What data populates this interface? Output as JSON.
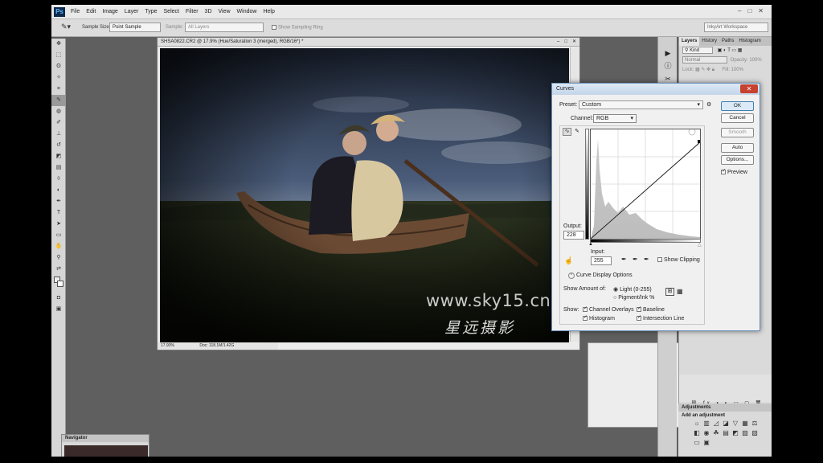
{
  "app": {
    "logo": "Ps",
    "workspace": "InkyArt Workspace"
  },
  "menu": [
    "File",
    "Edit",
    "Image",
    "Layer",
    "Type",
    "Select",
    "Filter",
    "3D",
    "View",
    "Window",
    "Help"
  ],
  "options": {
    "sample_size_label": "Sample Size:",
    "sample_size_value": "Point Sample",
    "sample_label": "Sample:",
    "sample_value": "All Layers",
    "show_ring_label": "Show Sampling Ring"
  },
  "document": {
    "title": "SHSA0822.CR2 @ 17.9% (Hue/Saturation 3 (merged), RGB/16*) *",
    "zoom": "17.93%",
    "doc_size": "Doc: 118.1M/1.42G"
  },
  "watermark": {
    "url": "www.sky15.cn",
    "chinese": "星远摄影"
  },
  "navigator": {
    "title": "Navigator"
  },
  "layers_panel": {
    "tabs": [
      "Layers",
      "History",
      "Paths",
      "Histogram"
    ],
    "kind_label": "Kind",
    "blend_mode": "Normal",
    "opacity_label": "Opacity:",
    "opacity_value": "100%",
    "lock_label": "Lock:",
    "fill_label": "Fill:",
    "fill_value": "100%"
  },
  "adjustments": {
    "title": "Adjustments",
    "subtitle": "Add an adjustment"
  },
  "curves": {
    "title": "Curves",
    "preset_label": "Preset:",
    "preset_value": "Custom",
    "channel_label": "Channel:",
    "channel_value": "RGB",
    "output_label": "Output:",
    "output_value": "228",
    "input_label": "Input:",
    "input_value": "255",
    "show_clipping": "Show Clipping",
    "display_options": "Curve Display Options",
    "show_amount_label": "Show Amount of:",
    "light_option": "Light  (0-255)",
    "pigment_option": "Pigment/Ink %",
    "show_label": "Show:",
    "channel_overlays": "Channel Overlays",
    "baseline": "Baseline",
    "histogram": "Histogram",
    "intersection_line": "Intersection Line",
    "buttons": {
      "ok": "OK",
      "cancel": "Cancel",
      "smooth": "Smooth",
      "auto": "Auto",
      "options": "Options..."
    },
    "preview_label": "Preview"
  }
}
